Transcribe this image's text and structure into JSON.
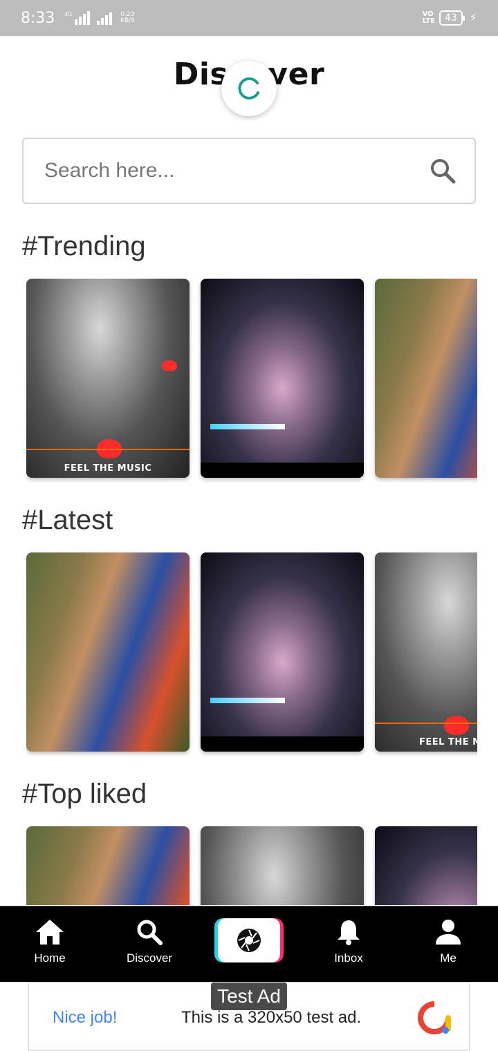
{
  "status_bar": {
    "time": "8:33",
    "network_tag": "4G",
    "speed_value": "0.23",
    "speed_unit": "KB/S",
    "volte_line1": "VO",
    "volte_line2": "LTE",
    "battery": "43"
  },
  "header": {
    "title": "Discover"
  },
  "search": {
    "placeholder": "Search here..."
  },
  "sections": [
    {
      "title": "#Trending",
      "items": [
        {
          "style": "bw",
          "caption": "FEEL THE MUSIC"
        },
        {
          "style": "night",
          "caption": ""
        },
        {
          "style": "outdoor",
          "caption": ""
        }
      ]
    },
    {
      "title": "#Latest",
      "items": [
        {
          "style": "outdoor",
          "caption": ""
        },
        {
          "style": "night",
          "caption": ""
        },
        {
          "style": "bw",
          "caption": "FEEL THE MU"
        }
      ]
    },
    {
      "title": "#Top liked",
      "items": [
        {
          "style": "outdoor",
          "caption": ""
        },
        {
          "style": "bw",
          "caption": ""
        },
        {
          "style": "night",
          "caption": ""
        }
      ]
    }
  ],
  "bottom_nav": {
    "home": "Home",
    "discover": "Discover",
    "inbox": "Inbox",
    "me": "Me"
  },
  "ad": {
    "label": "Test Ad",
    "nice": "Nice job!",
    "text": "This is a 320x50 test ad."
  },
  "colors": {
    "spinner": "#1a9e8f",
    "accent_cyan": "#20d5ec",
    "accent_pink": "#ff2a6a",
    "ad_blue": "#4285f4"
  }
}
